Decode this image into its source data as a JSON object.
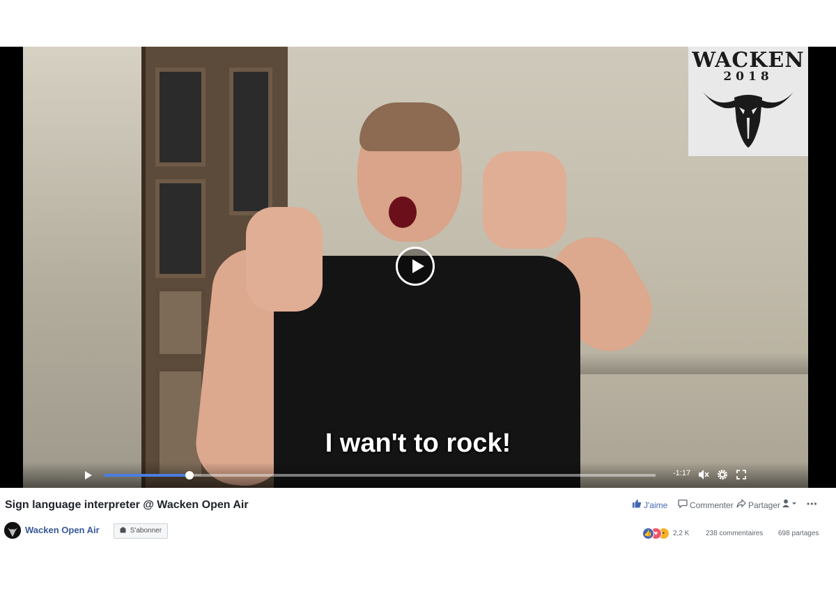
{
  "video": {
    "overlay_logo": {
      "name": "WACKEN",
      "year": "2018"
    },
    "subtitle": "I wan't to rock!",
    "progress": 0.155,
    "time_remaining": "-1:17"
  },
  "post": {
    "title": "Sign language interpreter @ Wacken Open Air",
    "page_name": "Wacken Open Air",
    "subscribe_label": "S'abonner",
    "like_label": "J'aime",
    "comment_label": "Commenter",
    "share_label": "Partager",
    "more_label": "•••",
    "reactions_count": "2,2 K",
    "comments_count": "238 commentaires",
    "shares_count": "698 partages"
  },
  "colors": {
    "accent": "#4267b2",
    "progress": "#4a7de0",
    "page_link": "#385898"
  },
  "icons": [
    "play-icon",
    "volume-mute-icon",
    "settings-gear-icon",
    "fullscreen-icon",
    "like-thumb-icon",
    "comment-icon",
    "share-arrow-icon",
    "audience-icon",
    "more-icon"
  ]
}
